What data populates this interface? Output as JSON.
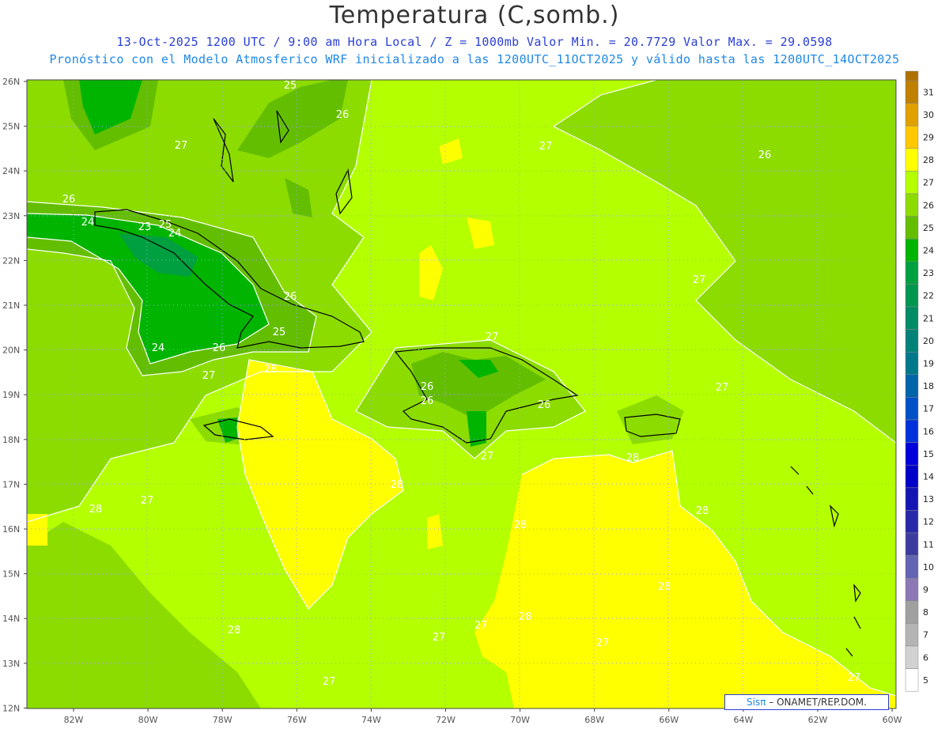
{
  "header": {
    "title": "Temperatura (C,somb.)",
    "line1": "13-Oct-2025  1200 UTC / 9:00 am Hora Local / Z = 1000mb   Valor Min. = 20.7729  Valor Max. = 29.0598",
    "line2": "Pronóstico con el Modelo Atmosferico WRF inicializado a las 1200UTC_11OCT2025 y válido hasta las  1200UTC_14OCT2025"
  },
  "axes": {
    "lat_labels": [
      "26N",
      "25N",
      "24N",
      "23N",
      "22N",
      "21N",
      "20N",
      "19N",
      "18N",
      "17N",
      "16N",
      "15N",
      "14N",
      "13N",
      "12N"
    ],
    "lon_labels": [
      "82W",
      "80W",
      "78W",
      "76W",
      "74W",
      "72W",
      "70W",
      "68W",
      "66W",
      "64W",
      "62W",
      "60W"
    ]
  },
  "colorbar": {
    "levels": [
      "31",
      "30",
      "29",
      "28",
      "27",
      "26",
      "25",
      "24",
      "23",
      "22",
      "21",
      "20",
      "19",
      "18",
      "17",
      "16",
      "15",
      "14",
      "13",
      "12",
      "11",
      "10",
      "9",
      "8",
      "7",
      "6",
      "5"
    ],
    "colors": [
      "#c08000",
      "#e0a000",
      "#ffc800",
      "#ffff00",
      "#b4ff00",
      "#8cdc00",
      "#64be00",
      "#00b400",
      "#00a040",
      "#009650",
      "#008c64",
      "#008278",
      "#00788c",
      "#0064aa",
      "#0050c8",
      "#0032dc",
      "#0000dc",
      "#0000c8",
      "#1414b4",
      "#2828aa",
      "#3c3ca0",
      "#6464b4",
      "#8c78b4",
      "#a0a0a0",
      "#b4b4b4",
      "#d2d2d2",
      "#ffffff"
    ]
  },
  "contour_labels": [
    "25",
    "26",
    "27",
    "26",
    "26",
    "24",
    "23",
    "25",
    "24",
    "26",
    "25",
    "27",
    "27",
    "26",
    "24",
    "26",
    "28",
    "27",
    "26",
    "26",
    "27",
    "28",
    "27",
    "28",
    "27",
    "28",
    "27",
    "28",
    "28",
    "28",
    "28",
    "27",
    "27",
    "27",
    "28",
    "27",
    "27"
  ],
  "credit": {
    "brand": "Sisπ",
    "text": "– ONAMET/REP.DOM."
  }
}
